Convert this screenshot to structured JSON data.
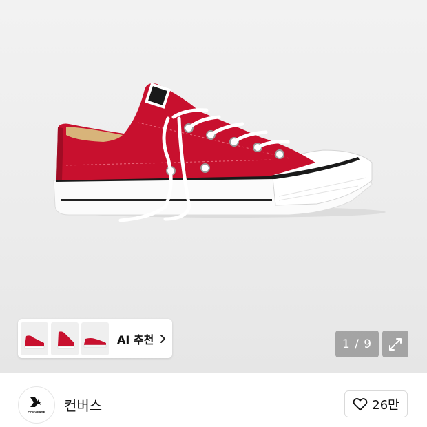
{
  "product": {
    "image_alt": "red low-top canvas sneaker",
    "thumbnails": [
      {
        "name": "thumb-1",
        "color": "#c8102e"
      },
      {
        "name": "thumb-2",
        "color": "#c8102e"
      },
      {
        "name": "thumb-3",
        "color": "#c8102e"
      }
    ],
    "ai_recommend_label": "AI 추천",
    "pager": "1 / 9"
  },
  "brand": {
    "logo_text": "CONVERSE",
    "name": "컨버스"
  },
  "like": {
    "count": "26만"
  },
  "colors": {
    "shoe_red": "#c8102e",
    "overlay": "#6e6e6e"
  }
}
